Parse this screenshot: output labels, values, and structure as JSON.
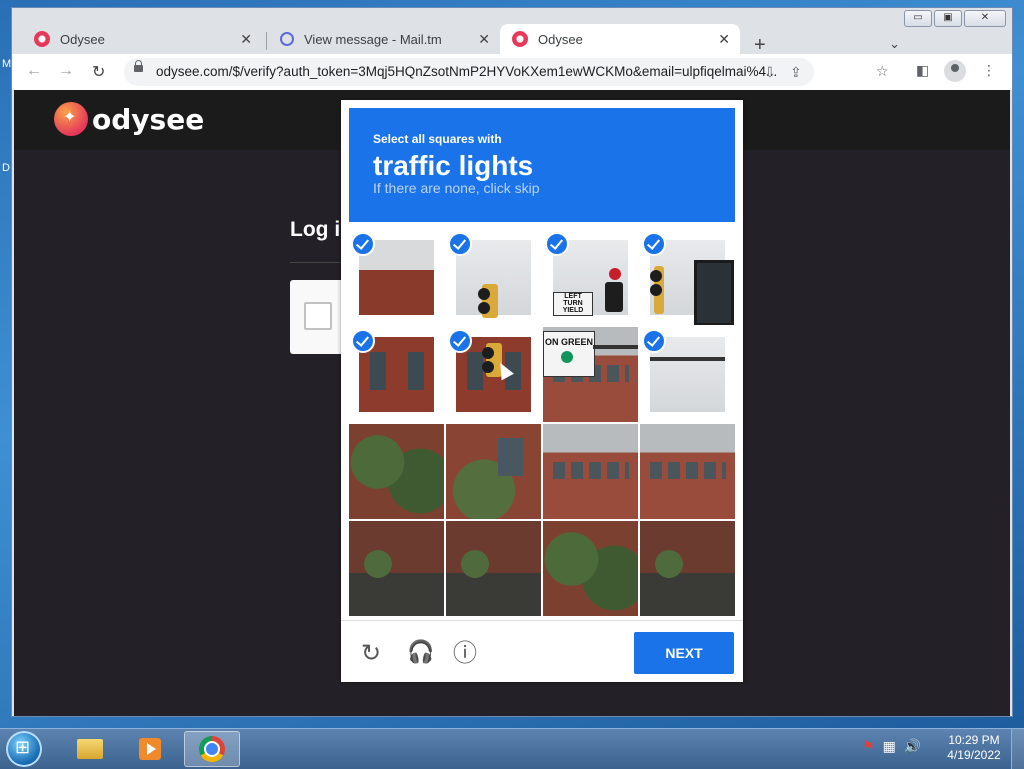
{
  "desktop": {
    "left_glyph_1": "M",
    "left_glyph_2": "D"
  },
  "window": {
    "minimize": "▭",
    "maximize": "▣",
    "close": "✕"
  },
  "tabs": [
    {
      "title": "Odysee",
      "close": "✕"
    },
    {
      "title": "View message - Mail.tm",
      "close": "✕"
    },
    {
      "title": "Odysee",
      "close": "✕",
      "active": true
    }
  ],
  "toolbar": {
    "new_tab": "+",
    "tab_menu": "⌄",
    "back": "←",
    "forward": "→",
    "reload": "↻",
    "url": "odysee.com/$/verify?auth_token=3Mqj5HQnZsotNmP2HYVoKXem1ewWCKMo&email=ulpfiqelmai%4...",
    "install": "⇩",
    "share": "⇪",
    "bookmark": "☆",
    "side_panel": "◧",
    "menu": "⋮"
  },
  "site": {
    "logo_text": "odysee",
    "login_title": "Log in"
  },
  "challenge": {
    "pre_title": "Select all squares with",
    "title": "traffic lights",
    "subtitle": "If there are none, click skip",
    "selected_tiles": [
      true,
      true,
      true,
      true,
      true,
      true,
      false,
      true,
      false,
      false,
      false,
      false,
      false,
      false,
      false,
      false
    ],
    "sign_left_turn": "LEFT TURN YIELD",
    "sign_on_green": "ON GREEN",
    "reload_icon": "↻",
    "audio_icon": "🎧",
    "info_icon": "ⓘ",
    "next_label": "NEXT"
  },
  "taskbar": {
    "clock_time": "10:29 PM",
    "clock_date": "4/19/2022",
    "tray_flag": "⚑",
    "tray_network": "▦",
    "tray_volume": "🔊"
  }
}
